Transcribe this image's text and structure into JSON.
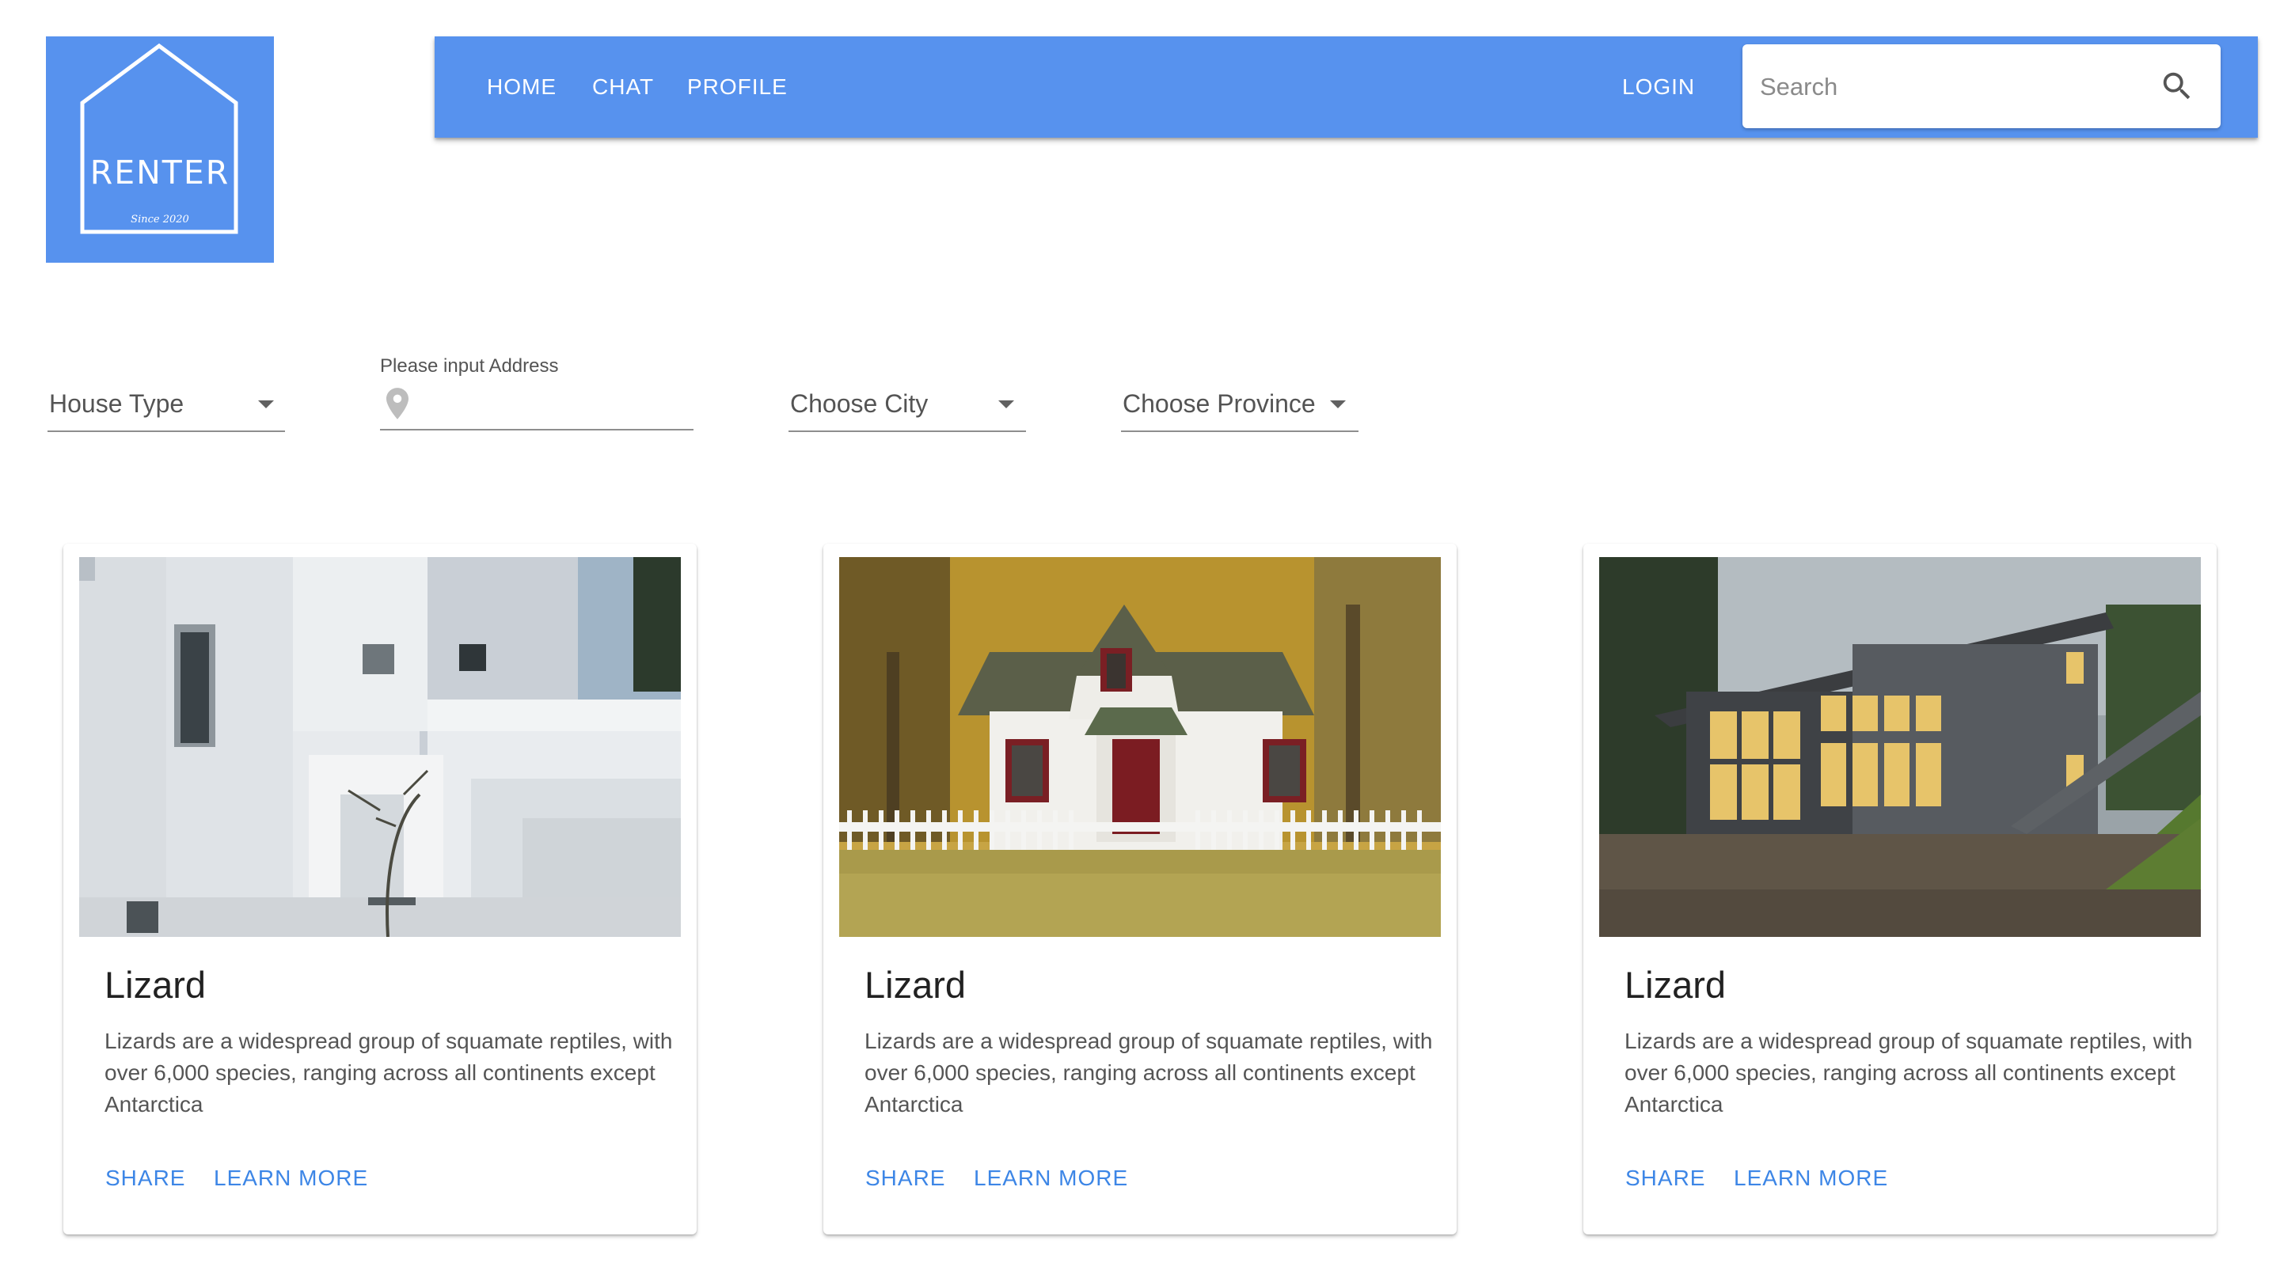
{
  "logo": {
    "name": "RENTER",
    "tagline": "Since 2020"
  },
  "nav": {
    "home": "HOME",
    "chat": "CHAT",
    "profile": "PROFILE",
    "login": "LOGIN"
  },
  "search": {
    "placeholder": "Search",
    "icon": "search-icon"
  },
  "filters": {
    "house_type": "House Type",
    "address_label": "Please input Address",
    "address_icon": "location-pin-icon",
    "city": "Choose City",
    "province": "Choose Province"
  },
  "cards": [
    {
      "title": "Lizard",
      "text": "Lizards are a widespread group of squamate reptiles, with over 6,000 species, ranging across all continents except Antarctica",
      "share": "SHARE",
      "learn_more": "LEARN MORE"
    },
    {
      "title": "Lizard",
      "text": "Lizards are a widespread group of squamate reptiles, with over 6,000 species, ranging across all continents except Antarctica",
      "share": "SHARE",
      "learn_more": "LEARN MORE"
    },
    {
      "title": "Lizard",
      "text": "Lizards are a widespread group of squamate reptiles, with over 6,000 species, ranging across all continents except Antarctica",
      "share": "SHARE",
      "learn_more": "LEARN MORE"
    }
  ],
  "colors": {
    "brand": "#5792ee",
    "action": "#3d86e6",
    "white": "#ffffff"
  }
}
